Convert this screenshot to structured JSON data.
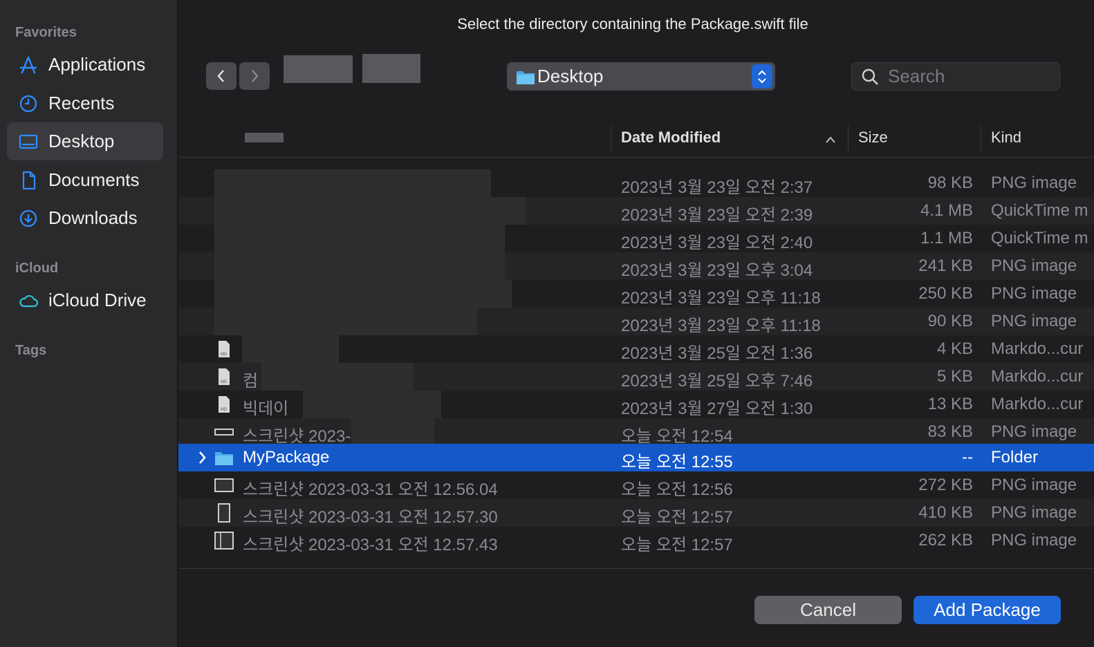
{
  "dialog": {
    "title": "Select the directory containing the Package.swift file"
  },
  "sidebar": {
    "favorites_title": "Favorites",
    "icloud_title": "iCloud",
    "tags_title": "Tags",
    "favorites": [
      {
        "label": "Applications",
        "icon": "applications-icon",
        "selected": false
      },
      {
        "label": "Recents",
        "icon": "clock-icon",
        "selected": false
      },
      {
        "label": "Desktop",
        "icon": "desktop-icon",
        "selected": true
      },
      {
        "label": "Documents",
        "icon": "document-icon",
        "selected": false
      },
      {
        "label": "Downloads",
        "icon": "download-icon",
        "selected": false
      }
    ],
    "icloud": [
      {
        "label": "iCloud Drive",
        "icon": "cloud-icon"
      }
    ]
  },
  "toolbar": {
    "location": "Desktop",
    "search_placeholder": "Search"
  },
  "table": {
    "columns": {
      "date": "Date Modified",
      "size": "Size",
      "kind": "Kind"
    },
    "rows": [
      {
        "name": "",
        "date": "2023년 3월 23일 오전 2:37",
        "size": "98 KB",
        "kind": "PNG image"
      },
      {
        "name": "",
        "date": "2023년 3월 23일 오전 2:39",
        "size": "4.1 MB",
        "kind": "QuickTime m"
      },
      {
        "name": "",
        "date": "2023년 3월 23일 오전 2:40",
        "size": "1.1 MB",
        "kind": "QuickTime m"
      },
      {
        "name": "",
        "date": "2023년 3월 23일 오후 3:04",
        "size": "241 KB",
        "kind": "PNG image"
      },
      {
        "name": "",
        "date": "2023년 3월 23일 오후 11:18",
        "size": "250 KB",
        "kind": "PNG image"
      },
      {
        "name": "",
        "date": "2023년 3월 23일 오후 11:18",
        "size": "90 KB",
        "kind": "PNG image"
      },
      {
        "name": "",
        "date": "2023년 3월 25일 오전 1:36",
        "size": "4 KB",
        "kind": "Markdo...cur"
      },
      {
        "name": "컴",
        "date": "2023년 3월 25일 오후 7:46",
        "size": "5 KB",
        "kind": "Markdo...cur"
      },
      {
        "name": "빅데이",
        "date": "2023년 3월 27일 오전 1:30",
        "size": "13 KB",
        "kind": "Markdo...cur"
      },
      {
        "name": "스크린샷 2023-",
        "date": "오늘 오전 12:54",
        "size": "83 KB",
        "kind": "PNG image"
      },
      {
        "name": "MyPackage",
        "date": "오늘 오전 12:55",
        "size": "--",
        "kind": "Folder"
      },
      {
        "name": "스크린샷 2023-03-31 오전 12.56.04",
        "date": "오늘 오전 12:56",
        "size": "272 KB",
        "kind": "PNG image"
      },
      {
        "name": "스크린샷 2023-03-31 오전 12.57.30",
        "date": "오늘 오전 12:57",
        "size": "410 KB",
        "kind": "PNG image"
      },
      {
        "name": "스크린샷 2023-03-31 오전 12.57.43",
        "date": "오늘 오전 12:57",
        "size": "262 KB",
        "kind": "PNG image"
      }
    ]
  },
  "buttons": {
    "cancel": "Cancel",
    "primary": "Add Package"
  },
  "colors": {
    "accent": "#1f66d6",
    "selection": "#1458c9"
  }
}
